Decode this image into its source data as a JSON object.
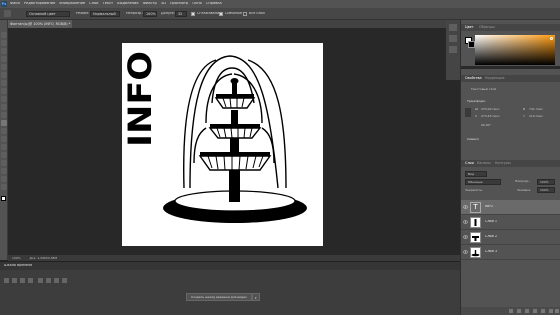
{
  "menubar": {
    "logo": "Ps",
    "items": [
      "Файл",
      "Редактирование",
      "Изображение",
      "Слои",
      "Текст",
      "Выделение",
      "Фильтр",
      "3D",
      "Просмотр",
      "Окно",
      "Справка"
    ]
  },
  "optbar": {
    "style_label": "Основной цвет",
    "mode_label": "Режим:",
    "mode_value": "Нормальный",
    "opacity_label": "Непрозр.:",
    "opacity_value": "100%",
    "tolerance_label": "Допуск:",
    "tolerance_value": "32",
    "antialias_label": "Сглаживание",
    "contiguous_label": "Смежные",
    "all_layers_label": "Все слои"
  },
  "document": {
    "tab_title": "Фонтан(ы)@ 100% (INFO, RGB/8) *",
    "artwork_text": "INFO",
    "status_zoom": "100%",
    "status_doc": "Док: 1,09М/4,38М"
  },
  "right_panel": {
    "color_tabs": [
      "Цвет",
      "Образцы"
    ],
    "props_tabs": [
      "Свойства",
      "Коррекция"
    ],
    "props_type": "Текстовый слой",
    "transform_label": "Трансформ.",
    "w_label": "Ш",
    "w_value": "233,99 пикс",
    "h_label": "В",
    "h_value": "741 пикс",
    "x_label": "X",
    "x_value": "273,63 пикс",
    "y_label": "Y",
    "y_value": "110 пикс",
    "angle_value": "90,00°",
    "char_label": "Символ",
    "layers_tabs": [
      "Слои",
      "Каналы",
      "Контуры"
    ],
    "layers_kind": "Вид",
    "layers_mode": "Обычные",
    "layers_opacity_label": "Непрозр.:",
    "layers_opacity_value": "100%",
    "lock_label": "Закрепить:",
    "fill_label": "Заливка:",
    "fill_value": "100%",
    "layers": [
      {
        "name": "INFO",
        "kind": "text",
        "selected": true
      },
      {
        "name": "Слой 1",
        "kind": "image",
        "selected": false
      },
      {
        "name": "Слой 2",
        "kind": "image",
        "selected": false
      },
      {
        "name": "Слой 3",
        "kind": "image",
        "selected": false
      }
    ]
  },
  "timeline": {
    "title": "Шкала времени",
    "create_button": "Создать шкалу времени для видео"
  },
  "colors": {
    "foreground": "#ffffff",
    "background": "#000000",
    "accent": "#1e90ff"
  }
}
